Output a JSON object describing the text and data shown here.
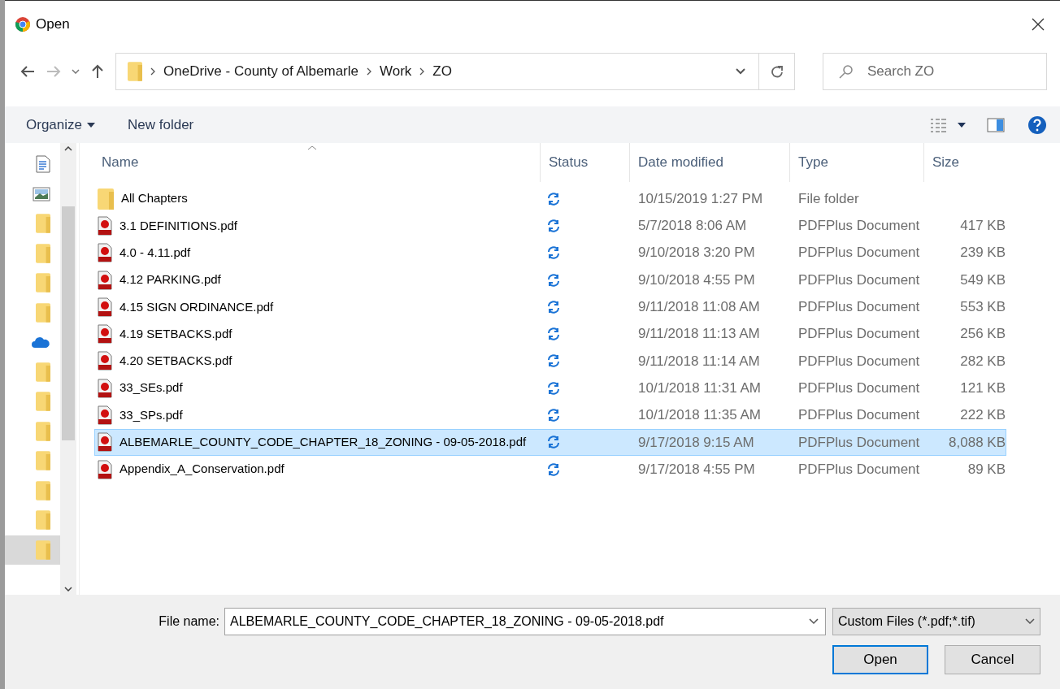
{
  "window": {
    "title": "Open"
  },
  "address": {
    "segments": [
      "OneDrive - County of Albemarle",
      "Work",
      "ZO"
    ]
  },
  "search": {
    "placeholder": "Search ZO"
  },
  "toolbar": {
    "organize": "Organize",
    "new_folder": "New folder"
  },
  "nav": {
    "items": [
      {
        "kind": "document",
        "selected": false
      },
      {
        "kind": "image",
        "selected": false
      },
      {
        "kind": "folder",
        "selected": false
      },
      {
        "kind": "folder",
        "selected": false
      },
      {
        "kind": "folder",
        "selected": false
      },
      {
        "kind": "folder",
        "selected": false
      },
      {
        "kind": "cloud",
        "selected": false
      },
      {
        "kind": "folder",
        "selected": false
      },
      {
        "kind": "folder",
        "selected": false
      },
      {
        "kind": "folder",
        "selected": false
      },
      {
        "kind": "folder",
        "selected": false
      },
      {
        "kind": "folder",
        "selected": false
      },
      {
        "kind": "folder",
        "selected": false
      },
      {
        "kind": "folder",
        "selected": true
      }
    ]
  },
  "table": {
    "columns": [
      "Name",
      "Status",
      "Date modified",
      "Type",
      "Size"
    ],
    "rows": [
      {
        "kind": "folder",
        "name": "All Chapters",
        "date": "10/15/2019 1:27 PM",
        "type": "File folder",
        "selected": false
      },
      {
        "kind": "pdf",
        "name": "3.1 DEFINITIONS.pdf",
        "date": "5/7/2018 8:06 AM",
        "type": "PDFPlus Document",
        "size": "417 KB",
        "selected": false
      },
      {
        "kind": "pdf",
        "name": "4.0 - 4.11.pdf",
        "date": "9/10/2018 3:20 PM",
        "type": "PDFPlus Document",
        "size": "239 KB",
        "selected": false
      },
      {
        "kind": "pdf",
        "name": "4.12 PARKING.pdf",
        "date": "9/10/2018 4:55 PM",
        "type": "PDFPlus Document",
        "size": "549 KB",
        "selected": false
      },
      {
        "kind": "pdf",
        "name": "4.15 SIGN ORDINANCE.pdf",
        "date": "9/11/2018 11:08 AM",
        "type": "PDFPlus Document",
        "size": "553 KB",
        "selected": false
      },
      {
        "kind": "pdf",
        "name": "4.19 SETBACKS.pdf",
        "date": "9/11/2018 11:13 AM",
        "type": "PDFPlus Document",
        "size": "256 KB",
        "selected": false
      },
      {
        "kind": "pdf",
        "name": "4.20 SETBACKS.pdf",
        "date": "9/11/2018 11:14 AM",
        "type": "PDFPlus Document",
        "size": "282 KB",
        "selected": false
      },
      {
        "kind": "pdf",
        "name": "33_SEs.pdf",
        "date": "10/1/2018 11:31 AM",
        "type": "PDFPlus Document",
        "size": "121 KB",
        "selected": false
      },
      {
        "kind": "pdf",
        "name": "33_SPs.pdf",
        "date": "10/1/2018 11:35 AM",
        "type": "PDFPlus Document",
        "size": "222 KB",
        "selected": false
      },
      {
        "kind": "pdf",
        "name": "ALBEMARLE_COUNTY_CODE_CHAPTER_18_ZONING - 09-05-2018.pdf",
        "date": "9/17/2018 9:15 AM",
        "type": "PDFPlus Document",
        "size": "8,088 KB",
        "selected": true
      },
      {
        "kind": "pdf",
        "name": "Appendix_A_Conservation.pdf",
        "date": "9/17/2018 4:55 PM",
        "type": "PDFPlus Document",
        "size": "89 KB",
        "selected": false
      }
    ]
  },
  "footer": {
    "file_name_label": "File name:",
    "file_name": "ALBEMARLE_COUNTY_CODE_CHAPTER_18_ZONING - 09-05-2018.pdf",
    "filter": "Custom Files (*.pdf;*.tif)",
    "open": "Open",
    "cancel": "Cancel"
  }
}
